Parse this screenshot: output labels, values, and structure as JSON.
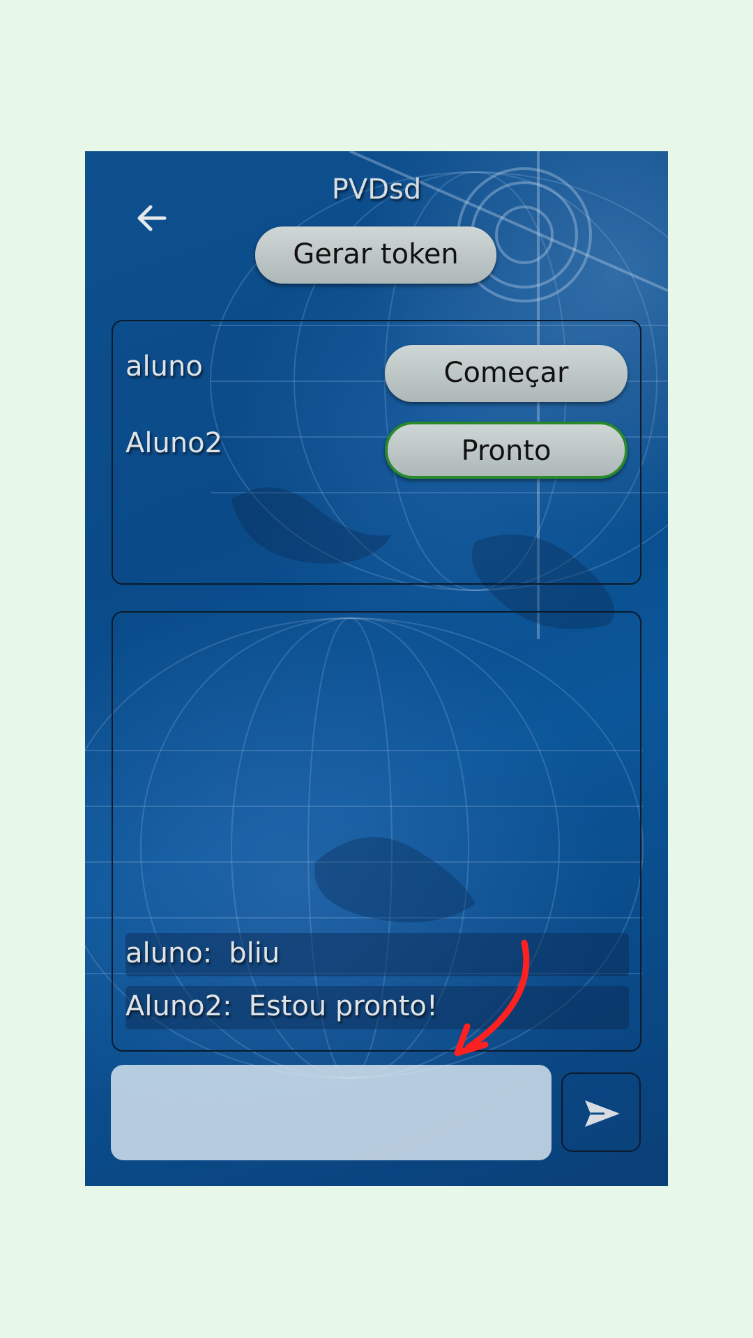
{
  "header": {
    "title": "PVDsd",
    "back_icon": "arrow-left-icon",
    "token_button_label": "Gerar token"
  },
  "players": [
    {
      "name": "aluno",
      "button_label": "Começar",
      "button_state": "start"
    },
    {
      "name": "Aluno2",
      "button_label": "Pronto",
      "button_state": "ready"
    }
  ],
  "chat": {
    "messages": [
      {
        "sender": "aluno:",
        "text": "bliu"
      },
      {
        "sender": "Aluno2:",
        "text": "Estou pronto!"
      }
    ]
  },
  "composer": {
    "input_value": "",
    "placeholder": "",
    "send_icon": "send-icon"
  },
  "colors": {
    "background": "#e8f8e8",
    "app_blue": "#0a4a88",
    "button_gray": "#bfc8c8",
    "ready_border": "#2a8a2a",
    "annotation_arrow": "#ff2020"
  }
}
